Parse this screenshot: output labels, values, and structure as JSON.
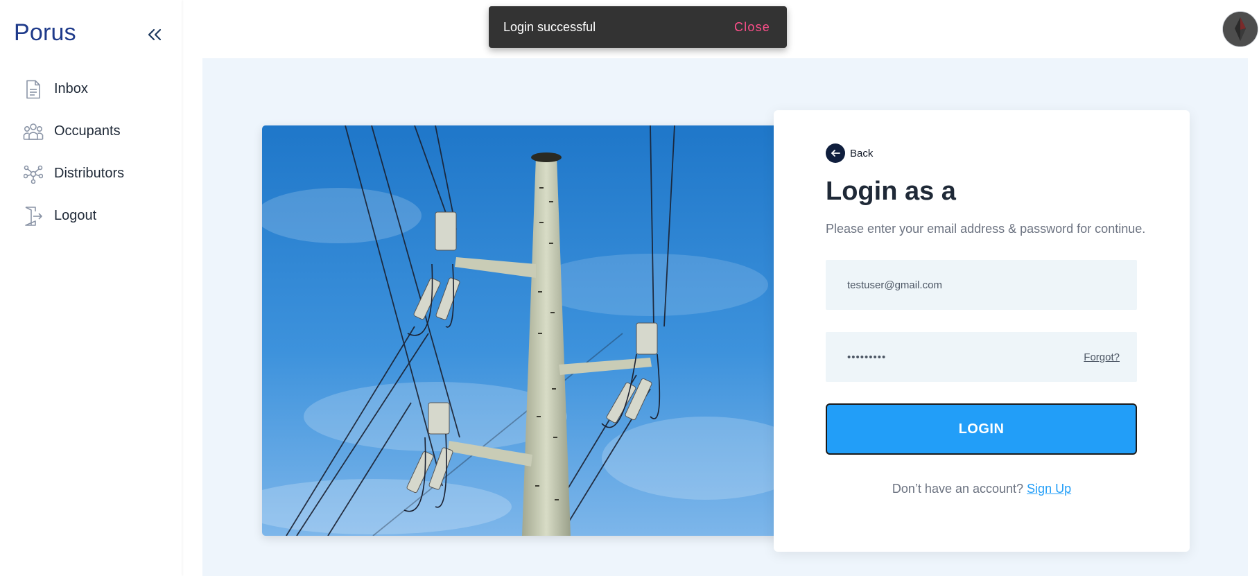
{
  "sidebar": {
    "brand": "Porus",
    "items": [
      {
        "label": "Inbox",
        "icon": "document-icon"
      },
      {
        "label": "Occupants",
        "icon": "people-icon"
      },
      {
        "label": "Distributors",
        "icon": "network-icon"
      },
      {
        "label": "Logout",
        "icon": "logout-icon"
      }
    ]
  },
  "toast": {
    "message": "Login successful",
    "close_label": "Close"
  },
  "login": {
    "back_label": "Back",
    "title": "Login as a",
    "subtitle": "Please enter your email address & password for continue.",
    "email_value": "testuser@gmail.com",
    "password_value": "•••••••••",
    "forgot_label": "Forgot?",
    "button_label": "LOGIN",
    "signup_prompt": "Don’t have an account?",
    "signup_label": "Sign Up"
  },
  "colors": {
    "brand": "#1e3a8a",
    "accent": "#229ef8",
    "main_bg": "#eef5fc",
    "toast_bg": "#333333",
    "toast_action": "#ff4f8b"
  }
}
